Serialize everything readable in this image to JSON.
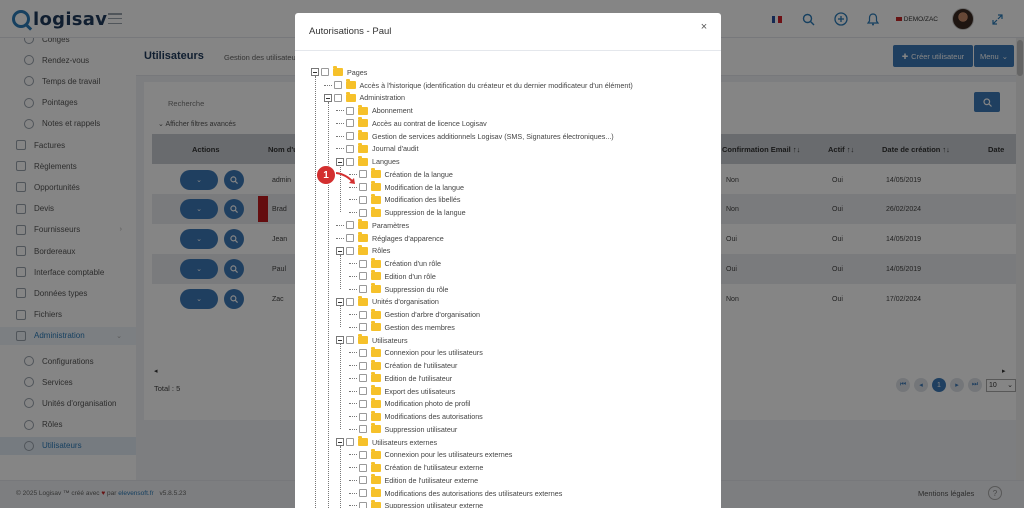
{
  "brand": {
    "name": "logisav"
  },
  "topbar": {
    "user_label": "DEMO/ZAC",
    "icons": [
      "flag-fr-icon",
      "search-icon",
      "plus-circle-icon",
      "bell-icon",
      "avatar",
      "expand-icon"
    ]
  },
  "sidebar": {
    "items": [
      {
        "label": "Congés",
        "icon": "calendar-icon",
        "level": 2
      },
      {
        "label": "Rendez-vous",
        "icon": "bell-icon",
        "level": 2
      },
      {
        "label": "Temps de travail",
        "icon": "clock-icon",
        "level": 2
      },
      {
        "label": "Pointages",
        "icon": "clipboard-icon",
        "level": 2
      },
      {
        "label": "Notes et rappels",
        "icon": "note-icon",
        "level": 2
      },
      {
        "label": "Factures",
        "icon": "invoice-icon",
        "level": 1
      },
      {
        "label": "Règlements",
        "icon": "payment-icon",
        "level": 1
      },
      {
        "label": "Opportunités",
        "icon": "target-icon",
        "level": 1
      },
      {
        "label": "Devis",
        "icon": "quote-icon",
        "level": 1
      },
      {
        "label": "Fournisseurs",
        "icon": "truck-icon",
        "level": 1
      },
      {
        "label": "Bordereaux",
        "icon": "list-icon",
        "level": 1
      },
      {
        "label": "Interface comptable",
        "icon": "link-icon",
        "level": 1
      },
      {
        "label": "Données types",
        "icon": "database-icon",
        "level": 1
      },
      {
        "label": "Fichiers",
        "icon": "file-icon",
        "level": 1
      },
      {
        "label": "Administration",
        "icon": "admin-icon",
        "level": 1,
        "state": "open"
      },
      {
        "label": "Configurations",
        "icon": "gear-icon",
        "level": 2
      },
      {
        "label": "Services",
        "icon": "service-icon",
        "level": 2
      },
      {
        "label": "Unités d'organisation",
        "icon": "org-icon",
        "level": 2
      },
      {
        "label": "Rôles",
        "icon": "role-icon",
        "level": 2
      },
      {
        "label": "Utilisateurs",
        "icon": "users-icon",
        "level": 2,
        "state": "active"
      }
    ]
  },
  "page": {
    "title": "Utilisateurs",
    "breadcrumb": "Gestion des utilisateurs",
    "create_button": "Créer utilisateur",
    "menu_button": "Menu"
  },
  "filters": {
    "search_label": "Recherche",
    "advanced_toggle": "Afficher filtres avancés"
  },
  "table": {
    "columns": [
      "Actions",
      "Nom d'u.. ↑↓",
      "Confirmation Email ↑↓",
      "Actif ↑↓",
      "Date de création ↑↓",
      "Date"
    ],
    "rows": [
      {
        "name": "admin",
        "confirmation": "Non",
        "actif": "Oui",
        "created": "14/05/2019"
      },
      {
        "name": "Brad",
        "confirmation": "Non",
        "actif": "Oui",
        "created": "26/02/2024"
      },
      {
        "name": "Jean",
        "confirmation": "Oui",
        "actif": "Oui",
        "created": "14/05/2019"
      },
      {
        "name": "Paul",
        "confirmation": "Oui",
        "actif": "Oui",
        "created": "14/05/2019"
      },
      {
        "name": "Zac",
        "confirmation": "Non",
        "actif": "Oui",
        "created": "17/02/2024"
      }
    ],
    "total": "Total : 5",
    "pager": {
      "current": "1",
      "page_size": "10"
    }
  },
  "footer": {
    "copyright_prefix": "© 2025 Logisav ™ créé avec",
    "copyright_by": "par",
    "copyright_brand": "elevensoft.fr",
    "version": "v5.8.5.23",
    "legal": "Mentions légales",
    "help": "?"
  },
  "modal": {
    "title": "Autorisations - Paul",
    "close": "×",
    "callout": "1",
    "tree": [
      {
        "label": "Pages",
        "depth": 0,
        "expandable": true
      },
      {
        "label": "Accès à l'historique (identification du créateur et du dernier modificateur d'un élément)",
        "depth": 1,
        "expandable": false
      },
      {
        "label": "Administration",
        "depth": 1,
        "expandable": true
      },
      {
        "label": "Abonnement",
        "depth": 2,
        "expandable": false
      },
      {
        "label": "Accès au contrat de licence Logisav",
        "depth": 2,
        "expandable": false
      },
      {
        "label": "Gestion de services additionnels Logisav (SMS, Signatures électroniques...)",
        "depth": 2,
        "expandable": false
      },
      {
        "label": "Journal d'audit",
        "depth": 2,
        "expandable": false
      },
      {
        "label": "Langues",
        "depth": 2,
        "expandable": true
      },
      {
        "label": "Création de la langue",
        "depth": 3,
        "expandable": false
      },
      {
        "label": "Modification de la langue",
        "depth": 3,
        "expandable": false
      },
      {
        "label": "Modification des libellés",
        "depth": 3,
        "expandable": false
      },
      {
        "label": "Suppression de la langue",
        "depth": 3,
        "expandable": false
      },
      {
        "label": "Paramètres",
        "depth": 2,
        "expandable": false
      },
      {
        "label": "Réglages d'apparence",
        "depth": 2,
        "expandable": false
      },
      {
        "label": "Rôles",
        "depth": 2,
        "expandable": true
      },
      {
        "label": "Création d'un rôle",
        "depth": 3,
        "expandable": false
      },
      {
        "label": "Edition d'un rôle",
        "depth": 3,
        "expandable": false
      },
      {
        "label": "Suppression du rôle",
        "depth": 3,
        "expandable": false
      },
      {
        "label": "Unités d'organisation",
        "depth": 2,
        "expandable": true
      },
      {
        "label": "Gestion d'arbre d'organisation",
        "depth": 3,
        "expandable": false
      },
      {
        "label": "Gestion des membres",
        "depth": 3,
        "expandable": false
      },
      {
        "label": "Utilisateurs",
        "depth": 2,
        "expandable": true
      },
      {
        "label": "Connexion pour les utilisateurs",
        "depth": 3,
        "expandable": false
      },
      {
        "label": "Création de l'utilisateur",
        "depth": 3,
        "expandable": false
      },
      {
        "label": "Edition de l'utilisateur",
        "depth": 3,
        "expandable": false
      },
      {
        "label": "Export des utilisateurs",
        "depth": 3,
        "expandable": false
      },
      {
        "label": "Modification photo de profil",
        "depth": 3,
        "expandable": false
      },
      {
        "label": "Modifications des autorisations",
        "depth": 3,
        "expandable": false
      },
      {
        "label": "Suppression utilisateur",
        "depth": 3,
        "expandable": false
      },
      {
        "label": "Utilisateurs externes",
        "depth": 2,
        "expandable": true
      },
      {
        "label": "Connexion pour les utilisateurs externes",
        "depth": 3,
        "expandable": false
      },
      {
        "label": "Création de l'utilisateur externe",
        "depth": 3,
        "expandable": false
      },
      {
        "label": "Edition de l'utilisateur externe",
        "depth": 3,
        "expandable": false
      },
      {
        "label": "Modifications des autorisations des utilisateurs externes",
        "depth": 3,
        "expandable": false
      },
      {
        "label": "Suppression utilisateur externe",
        "depth": 3,
        "expandable": false
      }
    ]
  },
  "colors": {
    "primary": "#3d7ab8",
    "folder": "#f6c12a",
    "callout": "#d32f2f",
    "brand_dark": "#1f3b5c"
  }
}
